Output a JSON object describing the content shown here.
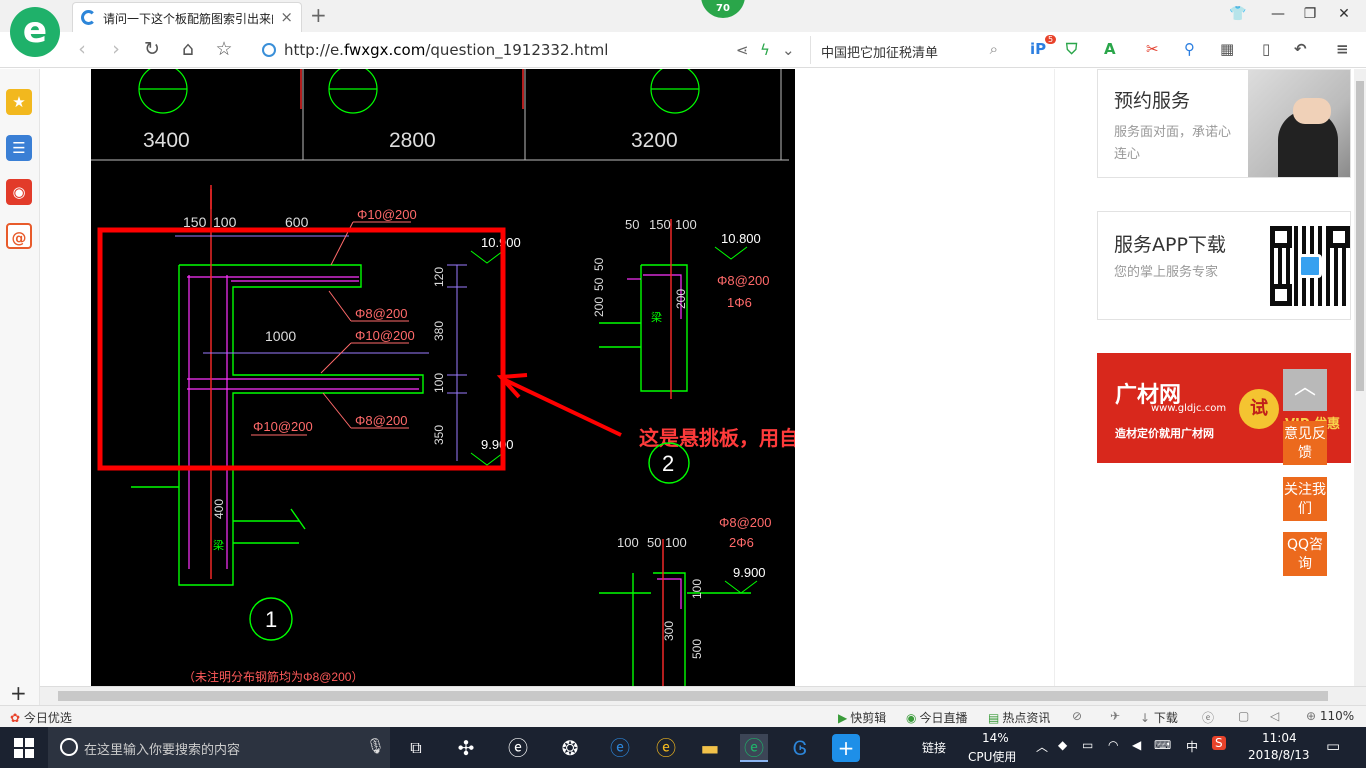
{
  "browser": {
    "logo_letter": "e",
    "tab_title": "请问一下这个板配筋图索引出来的",
    "tab_close": "×",
    "new_tab": "+",
    "badge": "70",
    "window": {
      "skin": "👕",
      "minimize": "—",
      "restore": "❐",
      "close": "✕"
    },
    "nav": {
      "back": "‹",
      "forward": "›",
      "refresh": "↻",
      "home": "⌂",
      "favorite": "☆"
    },
    "url_prefix": "http://e.",
    "url_domain": "fwxgx.com",
    "url_path": "/question_1912332.html",
    "share_icon": "share",
    "lightning_icon": "lightning",
    "dropdown_icon": "chevron-down",
    "search_text": "中国把它加征税清单",
    "extensions": [
      "ip",
      "shield",
      "translate",
      "scissors",
      "magnifier",
      "apps",
      "phone",
      "undo",
      "menu"
    ],
    "ext_badge": "5"
  },
  "sidebar": {
    "items": [
      {
        "name": "favorites-icon",
        "glyph": "★",
        "color": "#f2b81e"
      },
      {
        "name": "list-icon",
        "glyph": "☰",
        "color": "#3a7fd5"
      },
      {
        "name": "weibo-icon",
        "glyph": "◉",
        "color": "#e23b2a"
      },
      {
        "name": "mail-icon",
        "glyph": "@",
        "color": "#e85b2b"
      }
    ],
    "add": "+"
  },
  "cad": {
    "top_dims": [
      "3400",
      "2800",
      "3200"
    ],
    "main_dims_top": [
      "150",
      "100",
      "600"
    ],
    "main_rebar": [
      "Φ10@200",
      "Φ8@200",
      "Φ10@200",
      "Φ8@200",
      "Φ10@200"
    ],
    "main_span": "1000",
    "main_vertical_dims": [
      "120",
      "380",
      "100",
      "350"
    ],
    "main_elev_top": "10.900",
    "main_elev_bottom": "9.900",
    "beam_dim": "400",
    "beam_label": "梁",
    "detail1_label": "1",
    "note": "（未注明分布钢筋均为Φ8@200）",
    "d2_dims_top": [
      "50",
      "150",
      "100"
    ],
    "d2_elev": "10.800",
    "d2_rebar": [
      "Φ8@200",
      "1Φ6"
    ],
    "d2_vertical_dims": [
      "50",
      "50",
      "200"
    ],
    "d2_height": "200",
    "d2_label": "2",
    "d3_dims_top": [
      "100",
      "50",
      "100"
    ],
    "d3_elev": "9.900",
    "d3_rebar": [
      "Φ8@200",
      "2Φ6"
    ],
    "d3_vertical_dims": [
      "100",
      "300",
      "500"
    ],
    "annotation": "这是悬挑板，用自定义线定义",
    "colors": {
      "highlight": "#ff0000",
      "beam": "#00ff00",
      "dim": "#cfcfcf",
      "rebar": "#ff33ff",
      "elev": "#ffffff",
      "text": "#ff3b3b"
    }
  },
  "right": {
    "service_title": "预约服务",
    "service_desc": "服务面对面，承诺心连心",
    "app_title": "服务APP下载",
    "app_desc": "您的掌上服务专家",
    "ad_brand": "广材网",
    "ad_site": "www.gldjc.com",
    "ad_tagline": "造材定价就用广材网",
    "ad_try": "试",
    "ad_promo": "VIP 优惠试用"
  },
  "float": {
    "top": "︿",
    "feedback": "意见反馈",
    "follow": "关注我们",
    "qq": "QQ咨询"
  },
  "status": {
    "left": "今日优选",
    "items": [
      "快剪辑",
      "今日直播",
      "热点资讯"
    ],
    "download": "下载",
    "zoom": "110%"
  },
  "taskbar": {
    "search_placeholder": "在这里输入你要搜索的内容",
    "links": "链接",
    "cpu_percent": "14%",
    "cpu_label": "CPU使用",
    "ime": "中",
    "time": "11:04",
    "date": "2018/8/13"
  }
}
